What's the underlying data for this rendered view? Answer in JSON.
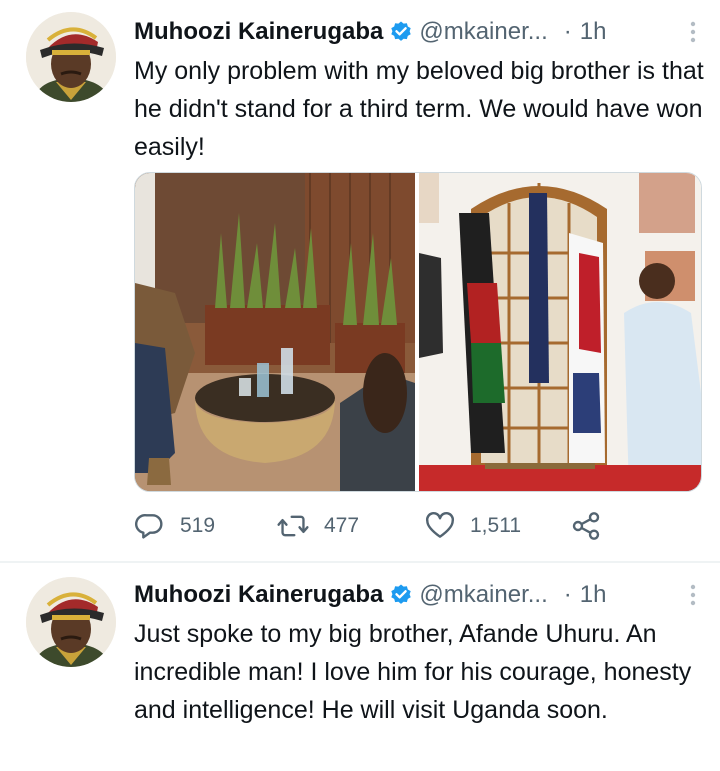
{
  "tweets": [
    {
      "name": "Muhoozi Kainerugaba",
      "handle": "@mkainer...",
      "time": "1h",
      "text": "My only problem with my beloved big brother is that he didn't stand for a third term. We would have won easily!",
      "stats": {
        "replies": "519",
        "retweets": "477",
        "likes": "1,511"
      }
    },
    {
      "name": "Muhoozi Kainerugaba",
      "handle": "@mkainer...",
      "time": "1h",
      "text": "Just spoke to my big brother, Afande Uhuru. An incredible man! I love him for his courage, honesty and intelligence! He will visit Uganda soon."
    }
  ],
  "separator": "·",
  "icons": {
    "verified": "verified-badge-icon",
    "more": "more-vertical-icon",
    "reply": "reply-icon",
    "retweet": "retweet-icon",
    "like": "heart-icon",
    "share": "share-icon"
  },
  "colors": {
    "verified": "#1d9bf0",
    "secondary_text": "#536471",
    "text": "#0f1419"
  }
}
